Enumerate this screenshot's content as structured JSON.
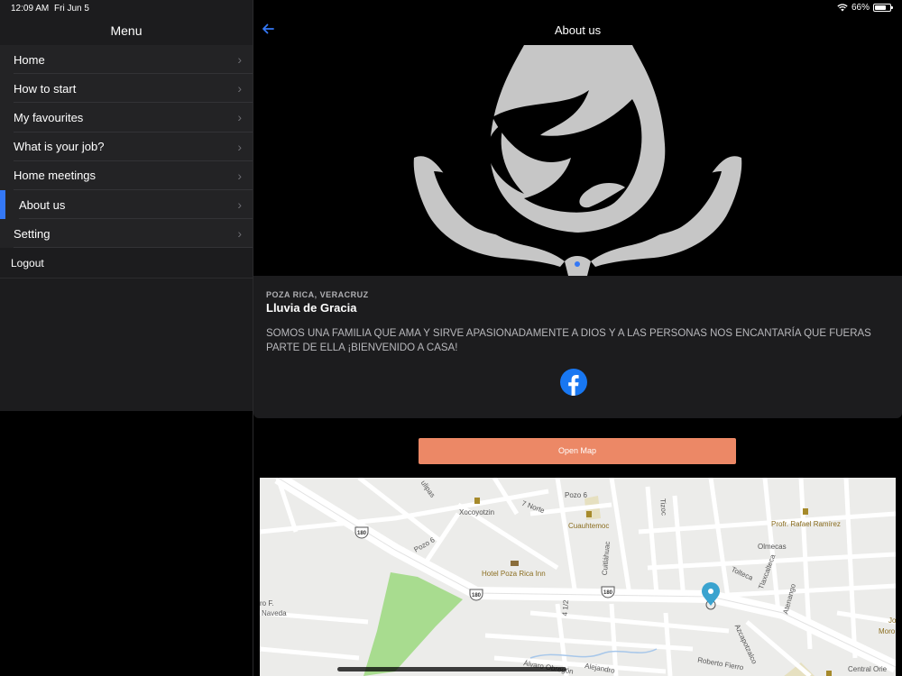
{
  "status_bar": {
    "time": "12:09 AM",
    "date": "Fri Jun 5",
    "battery": "66%",
    "battery_level": 0.66
  },
  "sidebar": {
    "title": "Menu",
    "items": [
      {
        "label": "Home"
      },
      {
        "label": "How to start"
      },
      {
        "label": "My favourites"
      },
      {
        "label": "What is your job?"
      },
      {
        "label": "Home meetings"
      },
      {
        "label": "About us",
        "active": true
      },
      {
        "label": "Setting"
      }
    ],
    "logout_label": "Logout"
  },
  "main": {
    "title": "About us",
    "card": {
      "location": "POZA RICA, VERACRUZ",
      "name": "Lluvia de Gracia",
      "description": "SOMOS UNA FAMILIA QUE AMA Y SIRVE APASIONADAMENTE A DIOS Y A LAS PERSONAS NOS ENCANTARÍA QUE FUERAS PARTE DE ELLA ¡BIENVENIDO A CASA!"
    },
    "open_map_label": "Open Map",
    "map": {
      "labels": [
        "Xocoyotzin",
        "7 Norte",
        "Pozo 6",
        "Cuauhtemoc",
        "Tizoc",
        "Profr. Rafael Ramírez",
        "Olmecas",
        "Tolteca",
        "Tlaxcalteca",
        "Atenango",
        "Cuitláhuac",
        "Hotel Poza Rica Inn",
        "Pozo 6",
        "Naveda",
        "4 1/2",
        "Azcapotzalco",
        "Roberto Fierro",
        "Álvaro Obregón",
        "Alejandro",
        "Central Orie",
        "Jo",
        "Moro",
        "ulipas",
        "ro F."
      ],
      "highway": "180"
    },
    "accent_color": "#3478f6",
    "button_color": "#ec8866"
  }
}
